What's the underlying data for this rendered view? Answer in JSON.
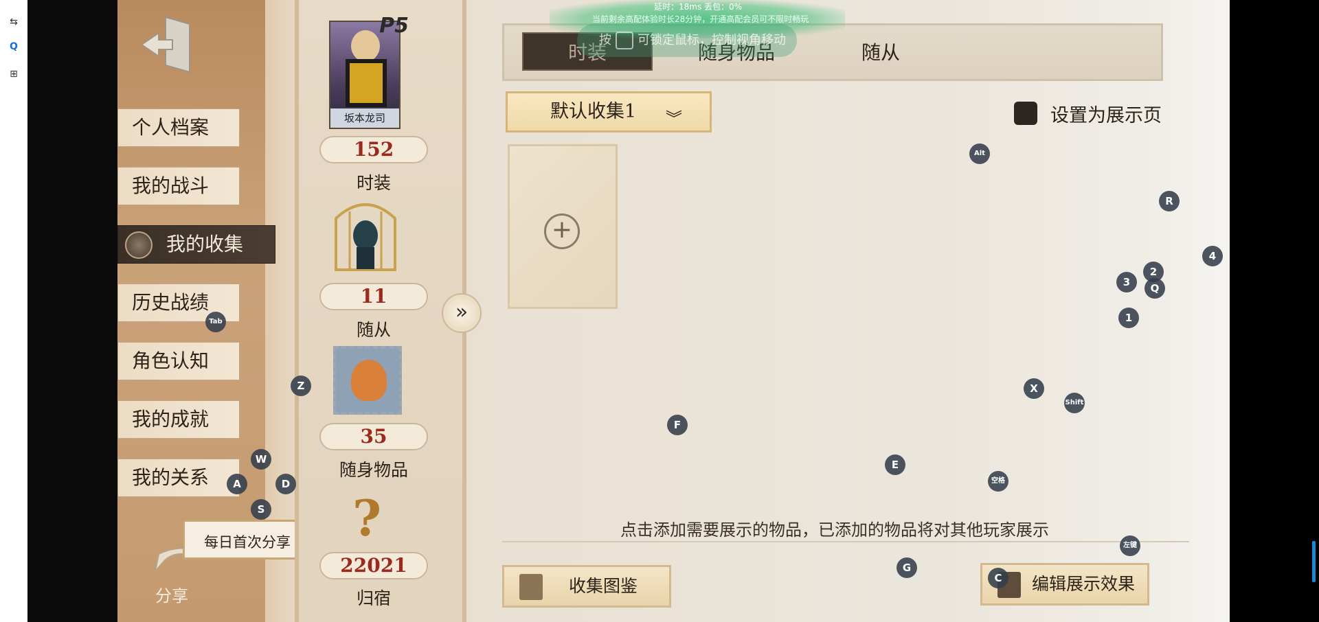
{
  "toolbar": {
    "icons": [
      "swap-icon",
      "q-icon",
      "add-square-icon"
    ]
  },
  "net_status": {
    "line1": "延时：18ms    丢包：0%",
    "line2": "当前剩余高配体验时长28分钟，开通高配会员可不限时畅玩"
  },
  "lock_hint": {
    "prefix": "按",
    "suffix": "可锁定鼠标，控制视角移动"
  },
  "nav": {
    "items": [
      {
        "label": "个人档案"
      },
      {
        "label": "我的战斗"
      },
      {
        "label": "我的收集"
      },
      {
        "label": "历史战绩"
      },
      {
        "label": "角色认知"
      },
      {
        "label": "我的成就"
      },
      {
        "label": "我的关系"
      }
    ],
    "active_index": 2
  },
  "share": {
    "bubble": "每日首次分享",
    "label": "分享"
  },
  "stats": [
    {
      "value": "152",
      "label": "时装",
      "portrait": "坂本龙司"
    },
    {
      "value": "11",
      "label": "随从"
    },
    {
      "value": "35",
      "label": "随身物品"
    },
    {
      "value": "22021",
      "label": "归宿"
    }
  ],
  "portrait_badge": "P5",
  "tabs": [
    {
      "label": "时装"
    },
    {
      "label": "随身物品"
    },
    {
      "label": "随从"
    }
  ],
  "dropdown": {
    "value": "默认收集1"
  },
  "display_toggle": {
    "label": "设置为展示页"
  },
  "hint": "点击添加需要展示的物品，已添加的物品将对其他玩家展示",
  "buttons": {
    "collection": "收集图鉴",
    "edit": "编辑展示效果"
  },
  "key_badges": [
    "Alt",
    "R",
    "4",
    "2",
    "3",
    "Q",
    "1",
    "Tab",
    "Z",
    "X",
    "Shift",
    "F",
    "E",
    "空格",
    "W",
    "A",
    "D",
    "S",
    "左键",
    "G",
    "C"
  ],
  "colors": {
    "accent_red": "#9b2a1e",
    "gold": "#d7b57a",
    "dark": "#3f342a",
    "overlay_green": "#3cbe78"
  }
}
